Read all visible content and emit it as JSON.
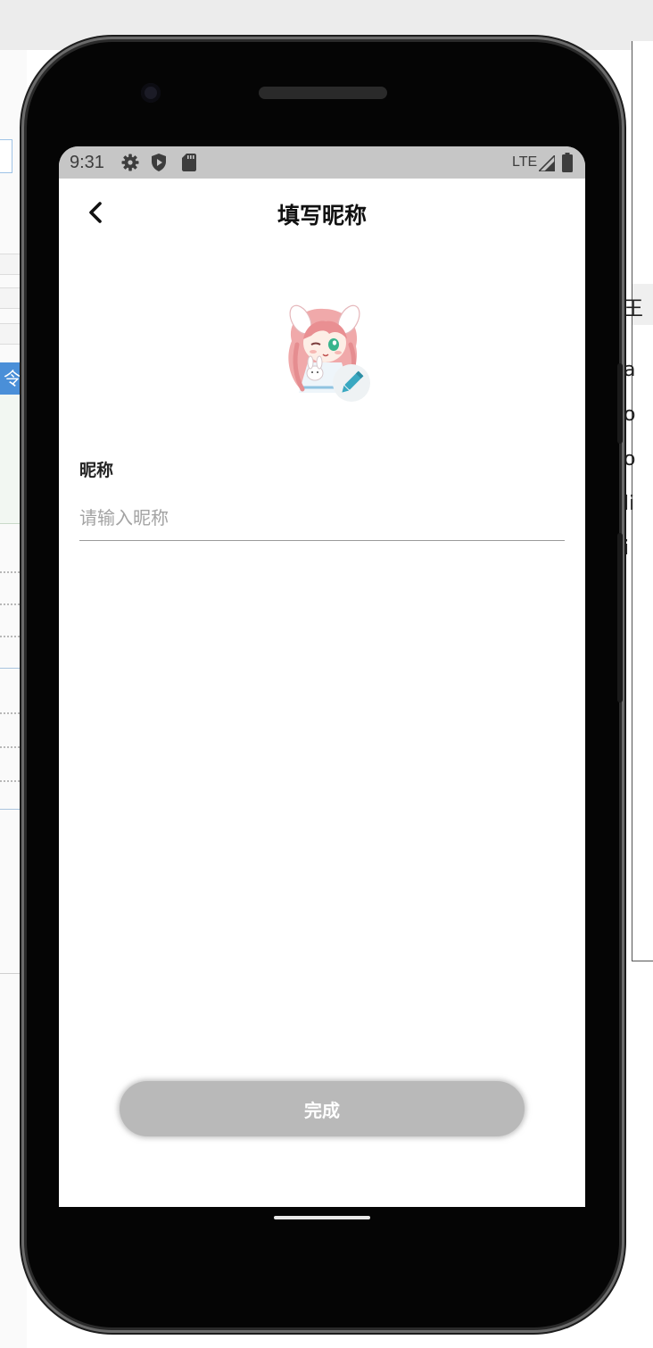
{
  "background": {
    "left_tag": "令",
    "right_fragments": [
      "a",
      "o",
      "o",
      "li",
      "i"
    ],
    "right_header": "王"
  },
  "statusbar": {
    "time": "9:31",
    "network": "LTE",
    "icons": [
      "gear-icon",
      "shield-play-icon",
      "sd-card-icon",
      "signal-icon",
      "battery-icon"
    ]
  },
  "header": {
    "back_icon": "chevron-left-icon",
    "title": "填写昵称"
  },
  "avatar": {
    "edit_icon": "pencil-icon",
    "edit_color": "#3aa8c1"
  },
  "form": {
    "nickname_label": "昵称",
    "nickname_value": "",
    "nickname_placeholder": "请输入昵称"
  },
  "actions": {
    "done_label": "完成",
    "done_color": "#b9b9b9"
  }
}
